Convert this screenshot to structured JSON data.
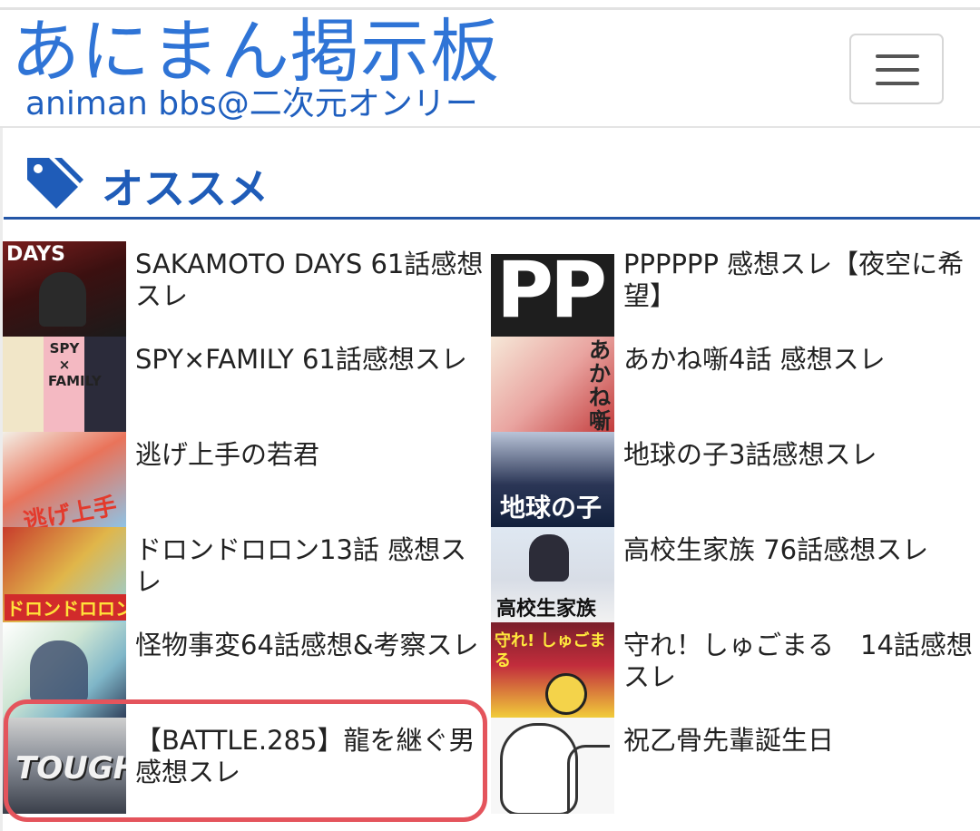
{
  "header": {
    "logo_main": "あにまん掲示板",
    "logo_sub": "animan bbs@二次元オンリー"
  },
  "section": {
    "title": "オススメ",
    "accent_color": "#2456a6"
  },
  "items": [
    {
      "title": "SAKAMOTO DAYS 61話感想スレ",
      "thumb_text": "DAYS"
    },
    {
      "title": "PPPPPP 感想スレ【夜空に希望】",
      "thumb_text": "PP"
    },
    {
      "title": "SPY×FAMILY 61話感想スレ",
      "thumb_text": "SPY × FAMILY"
    },
    {
      "title": "あかね噺4話 感想スレ",
      "thumb_text": "あかね噺"
    },
    {
      "title": "逃げ上手の若君",
      "thumb_text": "逃げ上手"
    },
    {
      "title": "地球の子3話感想スレ",
      "thumb_text": "地球の子"
    },
    {
      "title": "ドロンドロロン13話 感想スレ",
      "thumb_text": "ドロンドロロン"
    },
    {
      "title": "高校生家族 76話感想スレ",
      "thumb_text": "高校生家族"
    },
    {
      "title": "怪物事変64話感想&考察スレ",
      "thumb_text": ""
    },
    {
      "title": "守れ！しゅごまる　14話感想スレ",
      "thumb_text": "守れ! しゅごまる"
    },
    {
      "title": "【BATTLE.285】龍を継ぐ男 感想スレ",
      "thumb_text": "TOUGH"
    },
    {
      "title": "祝乙骨先輩誕生日",
      "thumb_text": ""
    }
  ],
  "highlighted_item": "【BATTLE.285】龍を継ぐ男 感想スレ",
  "highlight_color": "#e4545c"
}
